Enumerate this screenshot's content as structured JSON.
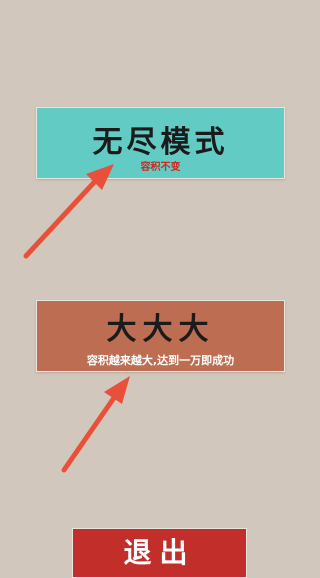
{
  "modes": {
    "endless": {
      "title": "无尽模式",
      "subtitle": "容积不变",
      "color": "#62cbc3"
    },
    "bigger": {
      "title": "大大大",
      "subtitle": "容积越来越大,达到一万即成功",
      "color": "#bd6e52"
    }
  },
  "exit": {
    "label": "退出",
    "color": "#c22f2b"
  },
  "background": "#d2c7bc",
  "arrow_color": "#e8503a",
  "icons": [
    "arrow-up-right-icon",
    "arrow-up-right-icon"
  ]
}
